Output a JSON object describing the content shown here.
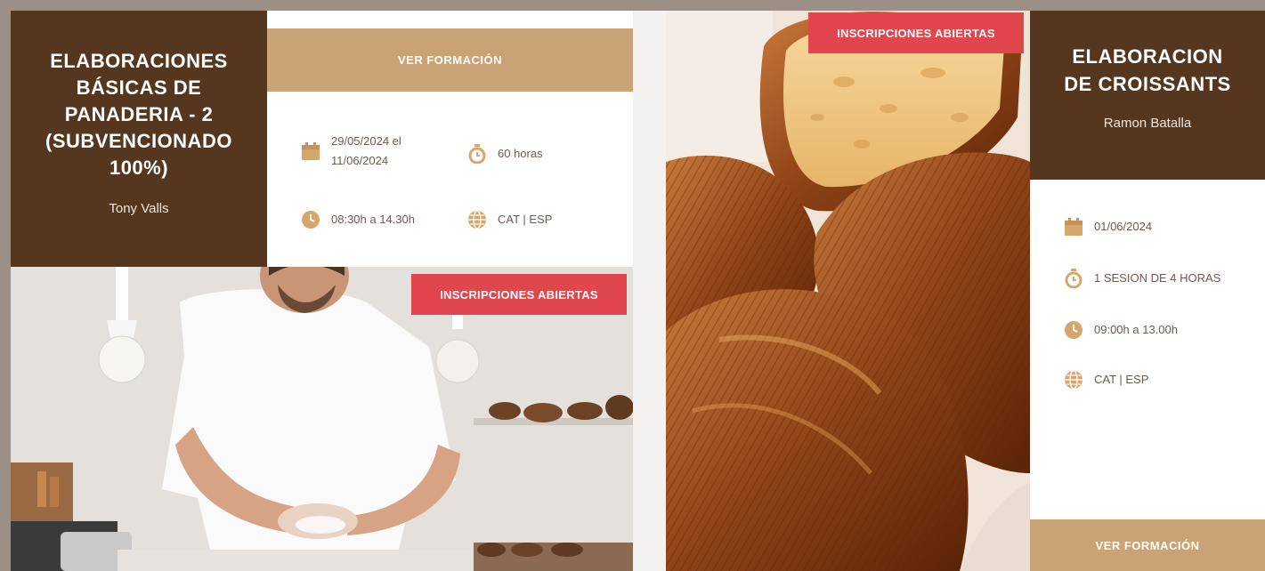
{
  "course1": {
    "title_lines": [
      "ELABORACIONES",
      "BÁSICAS DE",
      "PANADERIA - 2",
      "(SUBVENCIONADO",
      "100%)"
    ],
    "author": "Tony Valls",
    "button_label": "VER FORMACIÓN",
    "badge": "INSCRIPCIONES ABIERTAS",
    "dates_line1": "29/05/2024 el",
    "dates_line2": "11/06/2024",
    "duration": "60 horas",
    "schedule": "08:30h a 14.30h",
    "language": "CAT | ESP"
  },
  "course2": {
    "title_lines": [
      "ELABORACION",
      "DE CROISSANTS"
    ],
    "author": "Ramon Batalla",
    "button_label": "VER FORMACIÓN",
    "badge": "INSCRIPCIONES ABIERTAS",
    "date": "01/06/2024",
    "sessions": "1 SESION DE 4 HORAS",
    "schedule": "09:00h a 13.00h",
    "language": "CAT | ESP"
  },
  "colors": {
    "brown": "#55371f",
    "tan": "#c9a375",
    "badge_red": "#e0474c",
    "icon_tan": "#d6a66d"
  },
  "icons": [
    "calendar-icon",
    "timer-icon",
    "clock-icon",
    "globe-icon"
  ]
}
